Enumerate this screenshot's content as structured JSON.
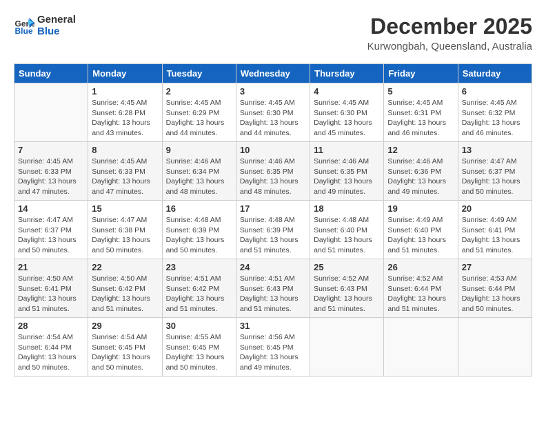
{
  "logo": {
    "line1": "General",
    "line2": "Blue"
  },
  "title": "December 2025",
  "subtitle": "Kurwongbah, Queensland, Australia",
  "days_of_week": [
    "Sunday",
    "Monday",
    "Tuesday",
    "Wednesday",
    "Thursday",
    "Friday",
    "Saturday"
  ],
  "weeks": [
    [
      {
        "day": "",
        "info": ""
      },
      {
        "day": "1",
        "info": "Sunrise: 4:45 AM\nSunset: 6:28 PM\nDaylight: 13 hours\nand 43 minutes."
      },
      {
        "day": "2",
        "info": "Sunrise: 4:45 AM\nSunset: 6:29 PM\nDaylight: 13 hours\nand 44 minutes."
      },
      {
        "day": "3",
        "info": "Sunrise: 4:45 AM\nSunset: 6:30 PM\nDaylight: 13 hours\nand 44 minutes."
      },
      {
        "day": "4",
        "info": "Sunrise: 4:45 AM\nSunset: 6:30 PM\nDaylight: 13 hours\nand 45 minutes."
      },
      {
        "day": "5",
        "info": "Sunrise: 4:45 AM\nSunset: 6:31 PM\nDaylight: 13 hours\nand 46 minutes."
      },
      {
        "day": "6",
        "info": "Sunrise: 4:45 AM\nSunset: 6:32 PM\nDaylight: 13 hours\nand 46 minutes."
      }
    ],
    [
      {
        "day": "7",
        "info": "Sunrise: 4:45 AM\nSunset: 6:33 PM\nDaylight: 13 hours\nand 47 minutes."
      },
      {
        "day": "8",
        "info": "Sunrise: 4:45 AM\nSunset: 6:33 PM\nDaylight: 13 hours\nand 47 minutes."
      },
      {
        "day": "9",
        "info": "Sunrise: 4:46 AM\nSunset: 6:34 PM\nDaylight: 13 hours\nand 48 minutes."
      },
      {
        "day": "10",
        "info": "Sunrise: 4:46 AM\nSunset: 6:35 PM\nDaylight: 13 hours\nand 48 minutes."
      },
      {
        "day": "11",
        "info": "Sunrise: 4:46 AM\nSunset: 6:35 PM\nDaylight: 13 hours\nand 49 minutes."
      },
      {
        "day": "12",
        "info": "Sunrise: 4:46 AM\nSunset: 6:36 PM\nDaylight: 13 hours\nand 49 minutes."
      },
      {
        "day": "13",
        "info": "Sunrise: 4:47 AM\nSunset: 6:37 PM\nDaylight: 13 hours\nand 50 minutes."
      }
    ],
    [
      {
        "day": "14",
        "info": "Sunrise: 4:47 AM\nSunset: 6:37 PM\nDaylight: 13 hours\nand 50 minutes."
      },
      {
        "day": "15",
        "info": "Sunrise: 4:47 AM\nSunset: 6:38 PM\nDaylight: 13 hours\nand 50 minutes."
      },
      {
        "day": "16",
        "info": "Sunrise: 4:48 AM\nSunset: 6:39 PM\nDaylight: 13 hours\nand 50 minutes."
      },
      {
        "day": "17",
        "info": "Sunrise: 4:48 AM\nSunset: 6:39 PM\nDaylight: 13 hours\nand 51 minutes."
      },
      {
        "day": "18",
        "info": "Sunrise: 4:48 AM\nSunset: 6:40 PM\nDaylight: 13 hours\nand 51 minutes."
      },
      {
        "day": "19",
        "info": "Sunrise: 4:49 AM\nSunset: 6:40 PM\nDaylight: 13 hours\nand 51 minutes."
      },
      {
        "day": "20",
        "info": "Sunrise: 4:49 AM\nSunset: 6:41 PM\nDaylight: 13 hours\nand 51 minutes."
      }
    ],
    [
      {
        "day": "21",
        "info": "Sunrise: 4:50 AM\nSunset: 6:41 PM\nDaylight: 13 hours\nand 51 minutes."
      },
      {
        "day": "22",
        "info": "Sunrise: 4:50 AM\nSunset: 6:42 PM\nDaylight: 13 hours\nand 51 minutes."
      },
      {
        "day": "23",
        "info": "Sunrise: 4:51 AM\nSunset: 6:42 PM\nDaylight: 13 hours\nand 51 minutes."
      },
      {
        "day": "24",
        "info": "Sunrise: 4:51 AM\nSunset: 6:43 PM\nDaylight: 13 hours\nand 51 minutes."
      },
      {
        "day": "25",
        "info": "Sunrise: 4:52 AM\nSunset: 6:43 PM\nDaylight: 13 hours\nand 51 minutes."
      },
      {
        "day": "26",
        "info": "Sunrise: 4:52 AM\nSunset: 6:44 PM\nDaylight: 13 hours\nand 51 minutes."
      },
      {
        "day": "27",
        "info": "Sunrise: 4:53 AM\nSunset: 6:44 PM\nDaylight: 13 hours\nand 50 minutes."
      }
    ],
    [
      {
        "day": "28",
        "info": "Sunrise: 4:54 AM\nSunset: 6:44 PM\nDaylight: 13 hours\nand 50 minutes."
      },
      {
        "day": "29",
        "info": "Sunrise: 4:54 AM\nSunset: 6:45 PM\nDaylight: 13 hours\nand 50 minutes."
      },
      {
        "day": "30",
        "info": "Sunrise: 4:55 AM\nSunset: 6:45 PM\nDaylight: 13 hours\nand 50 minutes."
      },
      {
        "day": "31",
        "info": "Sunrise: 4:56 AM\nSunset: 6:45 PM\nDaylight: 13 hours\nand 49 minutes."
      },
      {
        "day": "",
        "info": ""
      },
      {
        "day": "",
        "info": ""
      },
      {
        "day": "",
        "info": ""
      }
    ]
  ]
}
